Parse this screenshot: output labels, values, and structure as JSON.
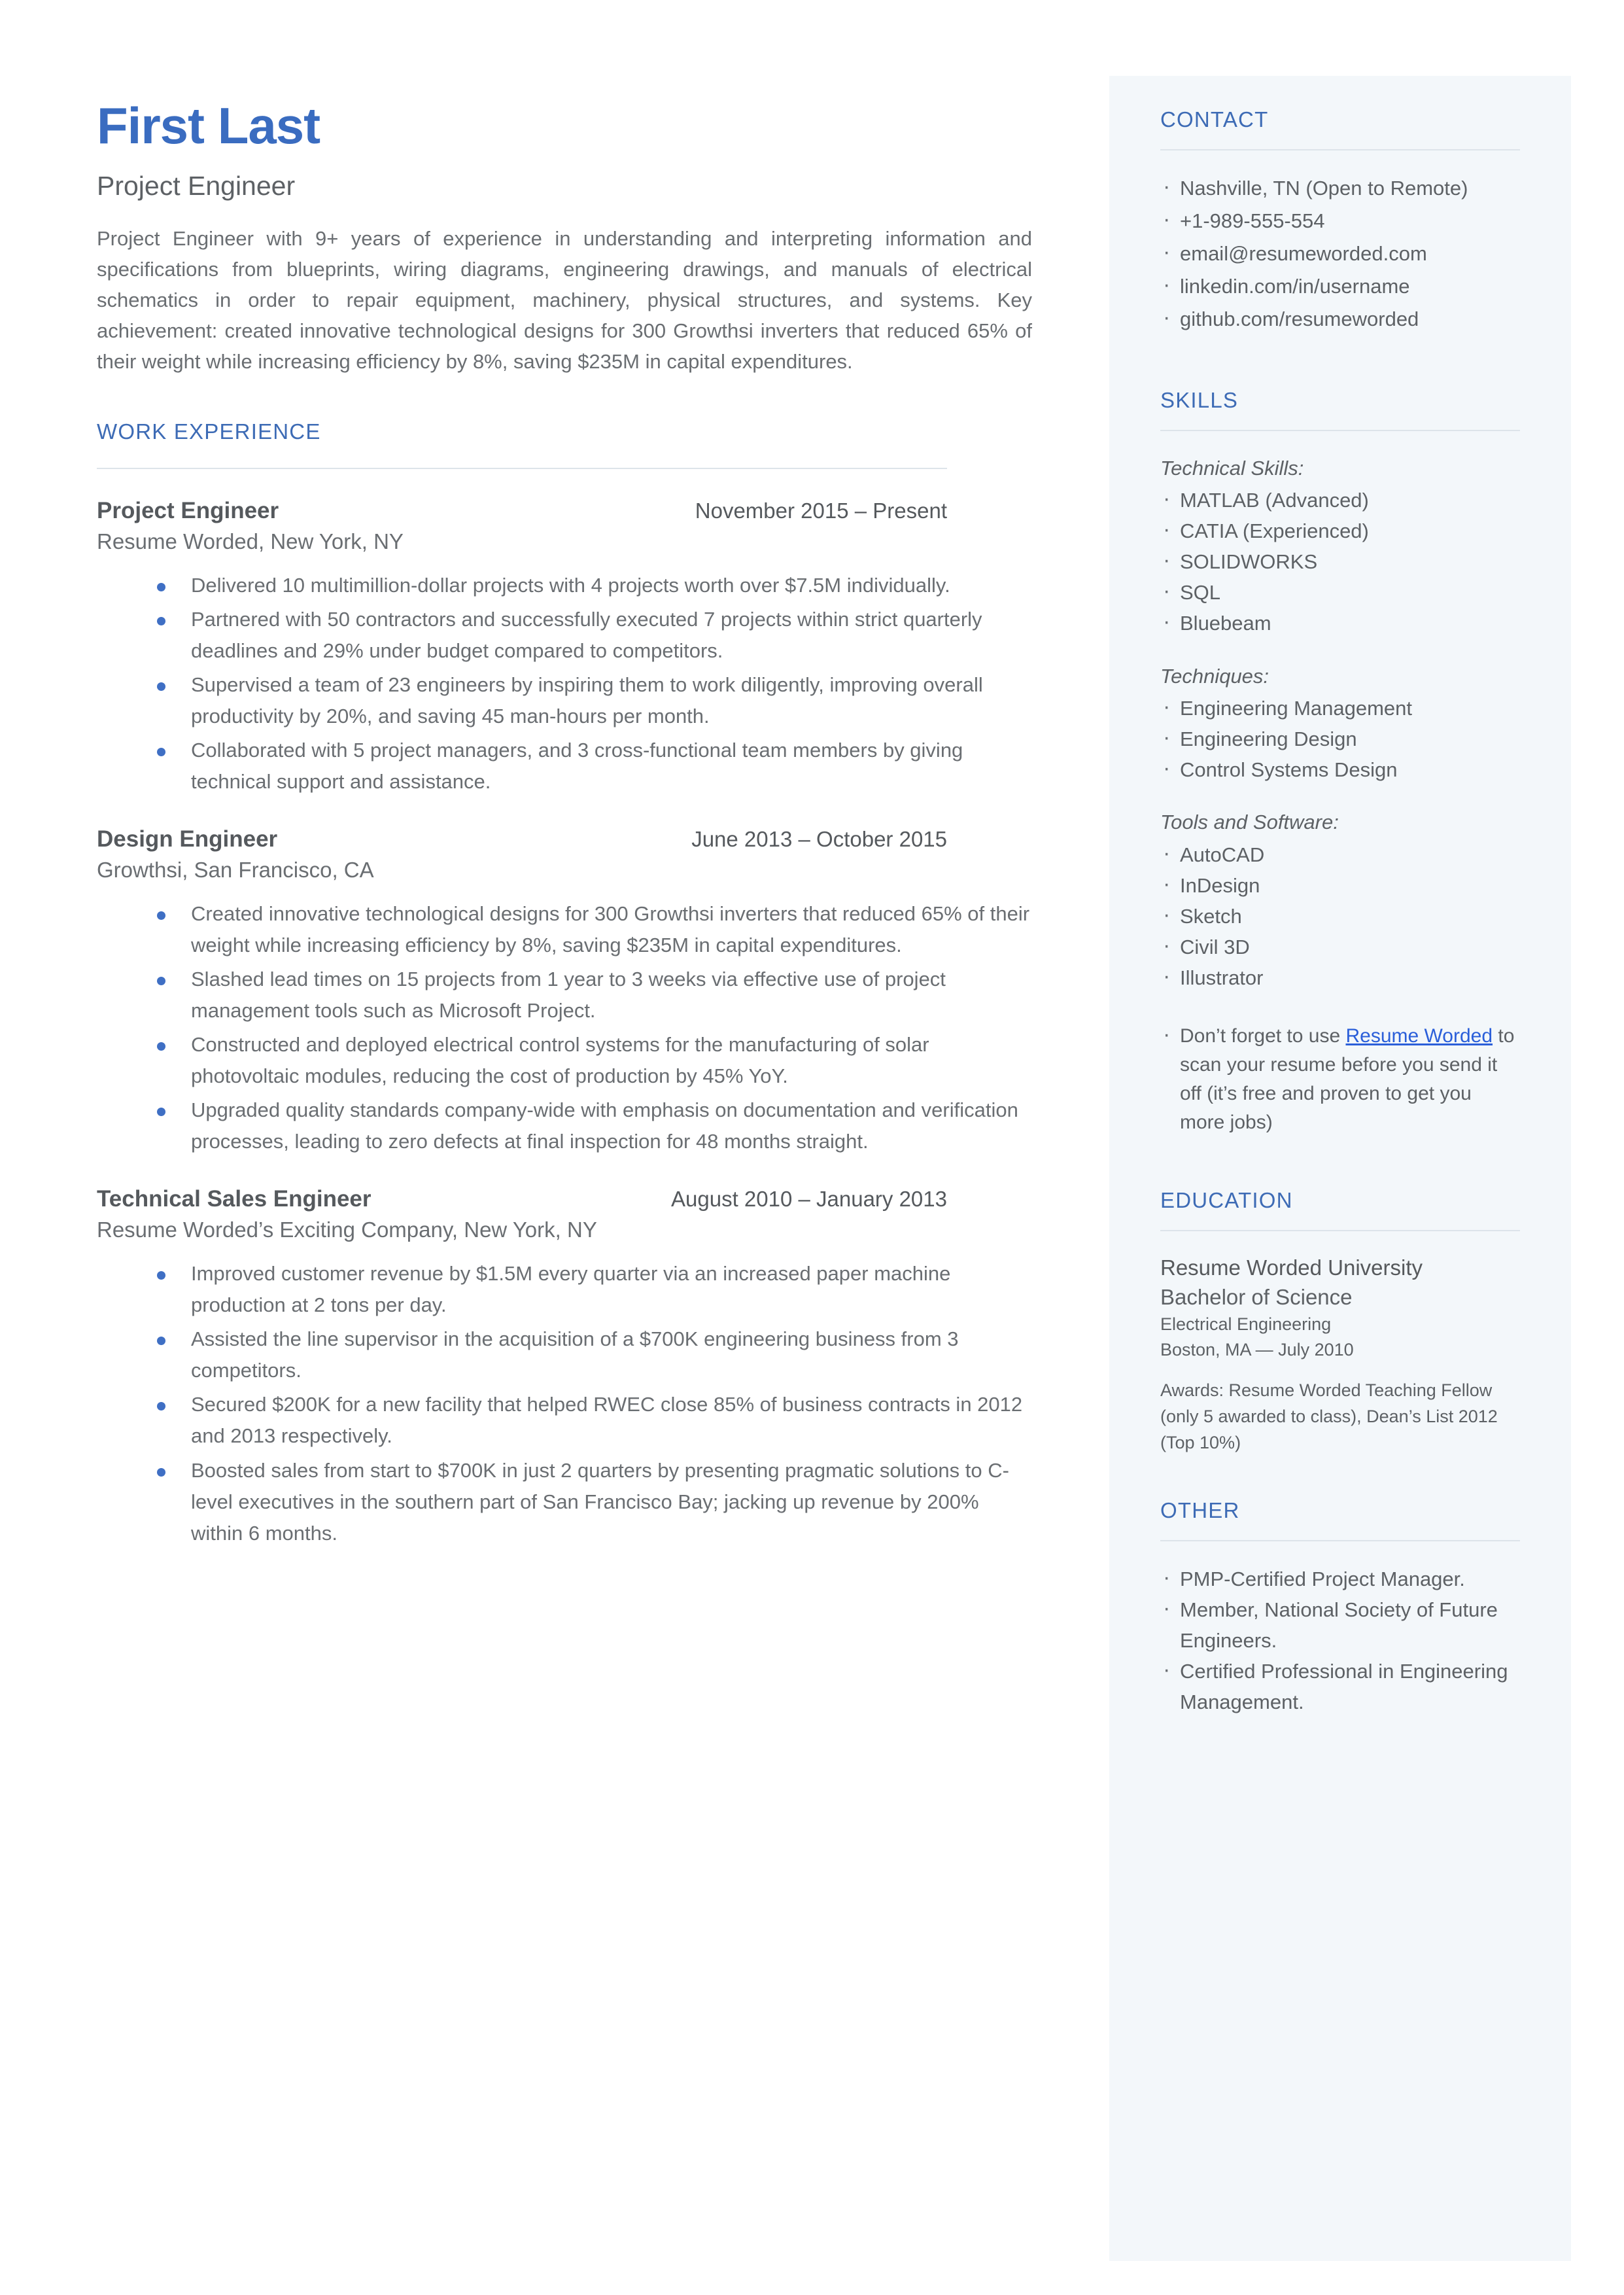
{
  "header": {
    "name": "First Last",
    "role": "Project Engineer",
    "summary": "Project Engineer with 9+ years of experience in understanding and interpreting information and specifications from blueprints, wiring diagrams, engineering drawings, and manuals of electrical schematics in order to repair equipment, machinery, physical structures, and systems. Key achievement: created innovative technological designs for 300 Growthsi inverters that reduced 65% of their weight while increasing efficiency by 8%, saving $235M in capital expenditures."
  },
  "work": {
    "heading": "WORK EXPERIENCE",
    "jobs": [
      {
        "title": "Project Engineer",
        "dates": "November 2015 – Present",
        "company": "Resume Worded, New York, NY",
        "bullets": [
          "Delivered 10 multimillion-dollar projects with 4 projects worth over $7.5M individually.",
          "Partnered with 50 contractors and successfully executed 7 projects within strict quarterly deadlines and 29% under budget compared to competitors.",
          "Supervised a team of 23 engineers by inspiring them to work diligently, improving overall productivity by 20%, and saving 45 man-hours per month.",
          "Collaborated with 5 project managers, and 3 cross-functional team members by giving technical support and assistance."
        ]
      },
      {
        "title": "Design Engineer",
        "dates": "June 2013 – October 2015",
        "company": "Growthsi, San Francisco, CA",
        "bullets": [
          "Created innovative technological designs for 300 Growthsi inverters that reduced 65% of their weight while increasing efficiency by 8%, saving $235M in capital expenditures.",
          "Slashed lead times on 15 projects from 1 year to 3 weeks via effective use of project management tools such as Microsoft Project.",
          "Constructed and deployed electrical control systems for the manufacturing of solar photovoltaic modules, reducing the cost of production by 45% YoY.",
          "Upgraded quality standards company-wide with emphasis on documentation and verification processes, leading to zero defects at final inspection for 48 months straight."
        ]
      },
      {
        "title": "Technical Sales Engineer",
        "dates": "August 2010 – January 2013",
        "company": "Resume Worded’s Exciting Company, New York, NY",
        "bullets": [
          "Improved customer revenue by $1.5M every quarter via an increased paper machine production at 2 tons per day.",
          "Assisted the line supervisor in the acquisition of a $700K engineering business from 3 competitors.",
          "Secured $200K for a new facility that helped RWEC close 85% of business contracts in 2012 and 2013 respectively.",
          "Boosted sales from start to $700K in just 2 quarters by presenting pragmatic solutions to C- level executives in the southern part of San Francisco Bay; jacking up revenue by 200% within 6 months."
        ]
      }
    ]
  },
  "contact": {
    "heading": "CONTACT",
    "items": [
      "Nashville, TN (Open to Remote)",
      "+1-989-555-554",
      "email@resumeworded.com",
      "linkedin.com/in/username",
      "github.com/resumeworded"
    ]
  },
  "skills": {
    "heading": "SKILLS",
    "groups": [
      {
        "label": "Technical Skills:",
        "items": [
          "MATLAB (Advanced)",
          "CATIA (Experienced)",
          "SOLIDWORKS",
          "SQL",
          "Bluebeam"
        ]
      },
      {
        "label": "Techniques:",
        "items": [
          "Engineering Management",
          "Engineering Design",
          "Control Systems Design"
        ]
      },
      {
        "label": "Tools and Software:",
        "items": [
          "AutoCAD",
          "InDesign",
          "Sketch",
          "Civil 3D",
          "Illustrator"
        ]
      }
    ],
    "promo": {
      "before": "Don’t forget to use ",
      "link": "Resume Worded",
      "after": " to scan your resume before you send it off (it’s free and proven to get you more jobs)"
    }
  },
  "education": {
    "heading": "EDUCATION",
    "school": "Resume Worded University",
    "degree": "Bachelor of Science",
    "field": "Electrical Engineering",
    "location": "Boston, MA — July 2010",
    "awards": "Awards: Resume Worded Teaching Fellow (only 5 awarded to class), Dean’s List 2012 (Top 10%)"
  },
  "other": {
    "heading": "OTHER",
    "items": [
      "PMP-Certified Project Manager.",
      "Member, National Society of Future Engineers.",
      "Certified Professional in Engineering Management."
    ]
  },
  "colors": {
    "accent": "#3d6bb5",
    "name": "#3a6cc0",
    "body_text": "#6a6e72",
    "sidebar_bg": "#f3f7fa",
    "bullet": "#3f6fc4",
    "link": "#2b5fd9",
    "rule": "#dde4ea"
  }
}
